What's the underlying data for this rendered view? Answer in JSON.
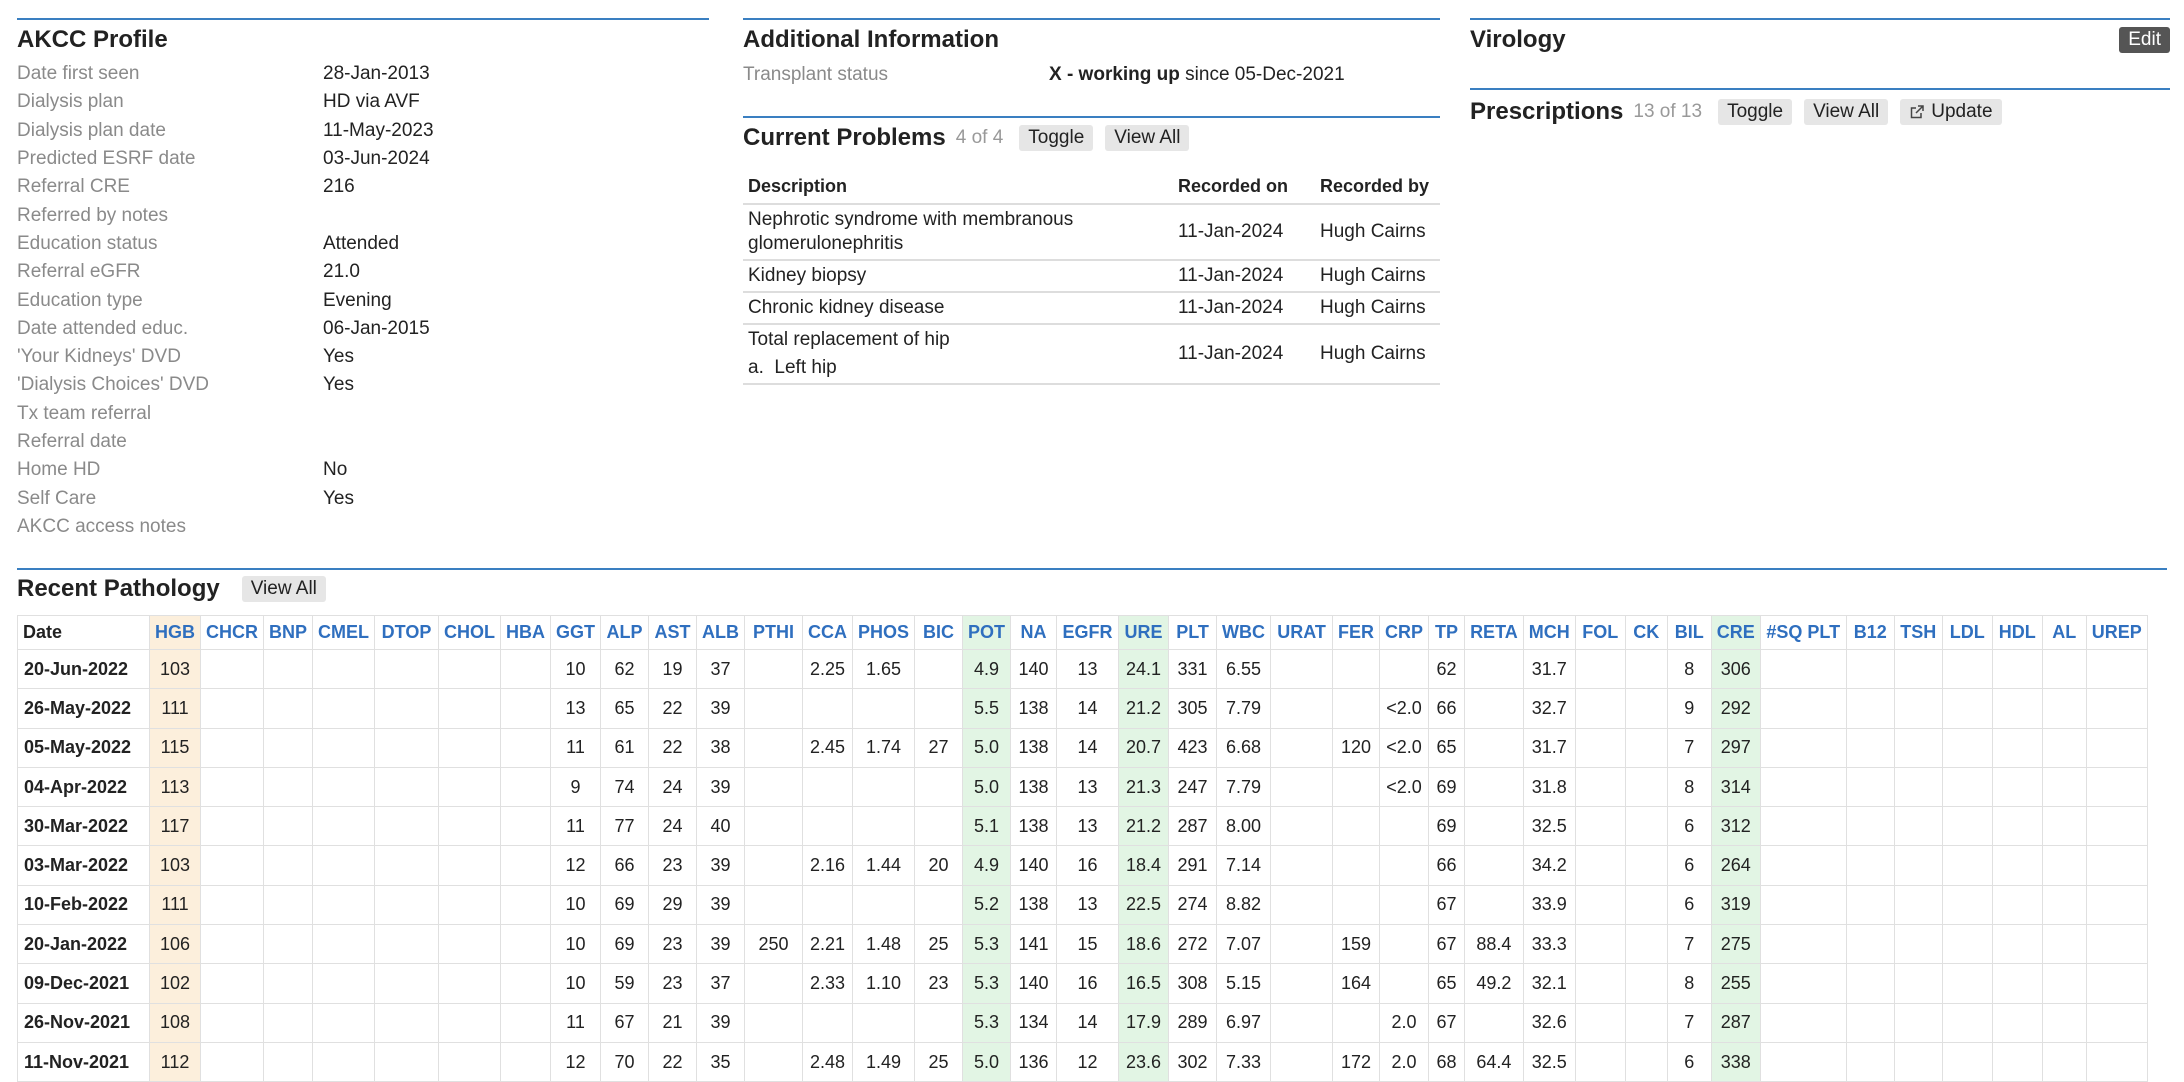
{
  "akcc": {
    "title": "AKCC Profile",
    "rows": [
      {
        "label": "Date first seen",
        "value": "28-Jan-2013"
      },
      {
        "label": "Dialysis plan",
        "value": "HD via AVF"
      },
      {
        "label": "Dialysis plan date",
        "value": "11-May-2023"
      },
      {
        "label": "Predicted ESRF date",
        "value": "03-Jun-2024"
      },
      {
        "label": "Referral CRE",
        "value": "216"
      },
      {
        "label": "Referred by notes",
        "value": ""
      },
      {
        "label": "Education status",
        "value": "Attended"
      },
      {
        "label": "Referral eGFR",
        "value": "21.0"
      },
      {
        "label": "Education type",
        "value": "Evening"
      },
      {
        "label": "Date attended educ.",
        "value": "06-Jan-2015"
      },
      {
        "label": "'Your Kidneys' DVD",
        "value": "Yes"
      },
      {
        "label": "'Dialysis Choices' DVD",
        "value": "Yes"
      },
      {
        "label": "Tx team referral",
        "value": ""
      },
      {
        "label": "Referral date",
        "value": ""
      },
      {
        "label": "Home HD",
        "value": "No"
      },
      {
        "label": "Self Care",
        "value": "Yes"
      },
      {
        "label": "AKCC access notes",
        "value": ""
      }
    ]
  },
  "additional": {
    "title": "Additional Information",
    "transplant_label": "Transplant status",
    "transplant_status": "X - working up",
    "transplant_since": " since 05-Dec-2021"
  },
  "problems": {
    "title": "Current Problems",
    "count": "4 of 4",
    "toggle": "Toggle",
    "view_all": "View All",
    "headers": [
      "Description",
      "Recorded on",
      "Recorded by"
    ],
    "rows": [
      {
        "desc": "Nephrotic syndrome with membranous glomerulonephritis",
        "sub": "",
        "on": "11-Jan-2024",
        "by": "Hugh Cairns"
      },
      {
        "desc": "Kidney biopsy",
        "sub": "",
        "on": "11-Jan-2024",
        "by": "Hugh Cairns"
      },
      {
        "desc": "Chronic kidney disease",
        "sub": "",
        "on": "11-Jan-2024",
        "by": "Hugh Cairns"
      },
      {
        "desc": "Total replacement of hip",
        "sub": "a.  Left hip",
        "on": "11-Jan-2024",
        "by": "Hugh Cairns"
      }
    ]
  },
  "virology": {
    "title": "Virology",
    "edit": "Edit"
  },
  "prescriptions": {
    "title": "Prescriptions",
    "count": "13 of 13",
    "toggle": "Toggle",
    "view_all": "View All",
    "update": "Update"
  },
  "pathology": {
    "title": "Recent Pathology",
    "view_all": "View All",
    "columns": [
      "Date",
      "HGB",
      "CHCR",
      "BNP",
      "CMEL",
      "DTOP",
      "CHOL",
      "HBA",
      "GGT",
      "ALP",
      "AST",
      "ALB",
      "PTHI",
      "CCA",
      "PHOS",
      "BIC",
      "POT",
      "NA",
      "EGFR",
      "URE",
      "PLT",
      "WBC",
      "URAT",
      "FER",
      "CRP",
      "TP",
      "RETA",
      "MCH",
      "FOL",
      "CK",
      "BIL",
      "CRE",
      "#SQ PLT",
      "B12",
      "TSH",
      "LDL",
      "HDL",
      "AL",
      "UREP"
    ],
    "rows": [
      [
        "20-Jun-2022",
        "103",
        "",
        "",
        "",
        "",
        "",
        "",
        "10",
        "62",
        "19",
        "37",
        "",
        "2.25",
        "1.65",
        "",
        "4.9",
        "140",
        "13",
        "24.1",
        "331",
        "6.55",
        "",
        "",
        "",
        "62",
        "",
        "31.7",
        "",
        "",
        "8",
        "306",
        "",
        "",
        "",
        "",
        "",
        "",
        ""
      ],
      [
        "26-May-2022",
        "111",
        "",
        "",
        "",
        "",
        "",
        "",
        "13",
        "65",
        "22",
        "39",
        "",
        "",
        "",
        "",
        "5.5",
        "138",
        "14",
        "21.2",
        "305",
        "7.79",
        "",
        "",
        "<2.0",
        "66",
        "",
        "32.7",
        "",
        "",
        "9",
        "292",
        "",
        "",
        "",
        "",
        "",
        "",
        ""
      ],
      [
        "05-May-2022",
        "115",
        "",
        "",
        "",
        "",
        "",
        "",
        "11",
        "61",
        "22",
        "38",
        "",
        "2.45",
        "1.74",
        "27",
        "5.0",
        "138",
        "14",
        "20.7",
        "423",
        "6.68",
        "",
        "120",
        "<2.0",
        "65",
        "",
        "31.7",
        "",
        "",
        "7",
        "297",
        "",
        "",
        "",
        "",
        "",
        "",
        ""
      ],
      [
        "04-Apr-2022",
        "113",
        "",
        "",
        "",
        "",
        "",
        "",
        "9",
        "74",
        "24",
        "39",
        "",
        "",
        "",
        "",
        "5.0",
        "138",
        "13",
        "21.3",
        "247",
        "7.79",
        "",
        "",
        "<2.0",
        "69",
        "",
        "31.8",
        "",
        "",
        "8",
        "314",
        "",
        "",
        "",
        "",
        "",
        "",
        ""
      ],
      [
        "30-Mar-2022",
        "117",
        "",
        "",
        "",
        "",
        "",
        "",
        "11",
        "77",
        "24",
        "40",
        "",
        "",
        "",
        "",
        "5.1",
        "138",
        "13",
        "21.2",
        "287",
        "8.00",
        "",
        "",
        "",
        "69",
        "",
        "32.5",
        "",
        "",
        "6",
        "312",
        "",
        "",
        "",
        "",
        "",
        "",
        ""
      ],
      [
        "03-Mar-2022",
        "103",
        "",
        "",
        "",
        "",
        "",
        "",
        "12",
        "66",
        "23",
        "39",
        "",
        "2.16",
        "1.44",
        "20",
        "4.9",
        "140",
        "16",
        "18.4",
        "291",
        "7.14",
        "",
        "",
        "",
        "66",
        "",
        "34.2",
        "",
        "",
        "6",
        "264",
        "",
        "",
        "",
        "",
        "",
        "",
        ""
      ],
      [
        "10-Feb-2022",
        "111",
        "",
        "",
        "",
        "",
        "",
        "",
        "10",
        "69",
        "29",
        "39",
        "",
        "",
        "",
        "",
        "5.2",
        "138",
        "13",
        "22.5",
        "274",
        "8.82",
        "",
        "",
        "",
        "67",
        "",
        "33.9",
        "",
        "",
        "6",
        "319",
        "",
        "",
        "",
        "",
        "",
        "",
        ""
      ],
      [
        "20-Jan-2022",
        "106",
        "",
        "",
        "",
        "",
        "",
        "",
        "10",
        "69",
        "23",
        "39",
        "250",
        "2.21",
        "1.48",
        "25",
        "5.3",
        "141",
        "15",
        "18.6",
        "272",
        "7.07",
        "",
        "159",
        "",
        "67",
        "88.4",
        "33.3",
        "",
        "",
        "7",
        "275",
        "",
        "",
        "",
        "",
        "",
        "",
        ""
      ],
      [
        "09-Dec-2021",
        "102",
        "",
        "",
        "",
        "",
        "",
        "",
        "10",
        "59",
        "23",
        "37",
        "",
        "2.33",
        "1.10",
        "23",
        "5.3",
        "140",
        "16",
        "16.5",
        "308",
        "5.15",
        "",
        "164",
        "",
        "65",
        "49.2",
        "32.1",
        "",
        "",
        "8",
        "255",
        "",
        "",
        "",
        "",
        "",
        "",
        ""
      ],
      [
        "26-Nov-2021",
        "108",
        "",
        "",
        "",
        "",
        "",
        "",
        "11",
        "67",
        "21",
        "39",
        "",
        "",
        "",
        "",
        "5.3",
        "134",
        "14",
        "17.9",
        "289",
        "6.97",
        "",
        "",
        "2.0",
        "67",
        "",
        "32.6",
        "",
        "",
        "7",
        "287",
        "",
        "",
        "",
        "",
        "",
        "",
        ""
      ],
      [
        "11-Nov-2021",
        "112",
        "",
        "",
        "",
        "",
        "",
        "",
        "12",
        "70",
        "22",
        "35",
        "",
        "2.48",
        "1.49",
        "25",
        "5.0",
        "136",
        "12",
        "23.6",
        "302",
        "7.33",
        "",
        "172",
        "2.0",
        "68",
        "64.4",
        "32.5",
        "",
        "",
        "6",
        "338",
        "",
        "",
        "",
        "",
        "",
        "",
        ""
      ]
    ]
  },
  "colors": {
    "accent_rule": "#3a7fc1",
    "link_header": "#2f6fbf",
    "hgb_bg": "#fcefdc",
    "highlight_bg": "#e2f5e4"
  },
  "icons": {
    "update": "external-edit-icon"
  }
}
